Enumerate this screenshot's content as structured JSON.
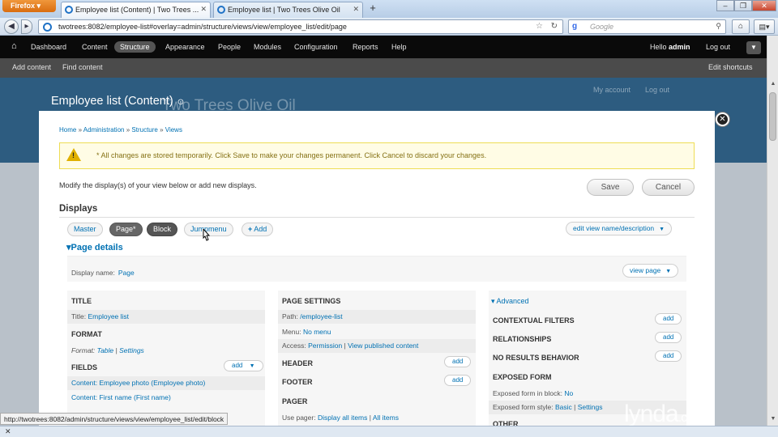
{
  "browser": {
    "firefox_label": "Firefox",
    "tabs": [
      {
        "title": "Employee list (Content) | Two Trees ..."
      },
      {
        "title": "Employee list | Two Trees Olive Oil"
      }
    ],
    "new_tab": "+",
    "url": "twotrees:8082/employee-list#overlay=admin/structure/views/view/employee_list/edit/page",
    "search_placeholder": "Google",
    "status_url": "http://twotrees:8082/admin/structure/views/view/employee_list/edit/block"
  },
  "toolbar": {
    "items": [
      "Dashboard",
      "Content",
      "Structure",
      "Appearance",
      "People",
      "Modules",
      "Configuration",
      "Reports",
      "Help"
    ],
    "hello_prefix": "Hello",
    "username": "admin",
    "logout": "Log out",
    "shortcuts": [
      "Add content",
      "Find content"
    ],
    "edit_shortcuts": "Edit shortcuts"
  },
  "site": {
    "name": "Two Trees Olive Oil",
    "my_account": "My account",
    "log_out": "Log out"
  },
  "overlay": {
    "title": "Employee list (Content)",
    "breadcrumb": [
      "Home",
      "Administration",
      "Structure",
      "Views"
    ],
    "warning": "* All changes are stored temporarily. Click Save to make your changes permanent. Click Cancel to discard your changes.",
    "intro": "Modify the display(s) of your view below or add new displays.",
    "save": "Save",
    "cancel": "Cancel",
    "displays_heading": "Displays",
    "display_tabs": [
      "Master",
      "Page*",
      "Block",
      "Jumpmenu"
    ],
    "add_display": "Add",
    "edit_view_name": "edit view name/description",
    "page_details": "Page details",
    "display_name_label": "Display name:",
    "display_name_value": "Page",
    "view_page": "view page"
  },
  "columns": {
    "left": {
      "title_h": "TITLE",
      "title_label": "Title:",
      "title_value": "Employee list",
      "format_h": "FORMAT",
      "format_label": "Format:",
      "format_value": "Table",
      "format_settings": "Settings",
      "fields_h": "FIELDS",
      "fields_add": "add",
      "fields": [
        "Content: Employee photo (Employee photo)",
        "Content: First name (First name)"
      ]
    },
    "middle": {
      "page_settings_h": "PAGE SETTINGS",
      "path_label": "Path:",
      "path_value": "/employee-list",
      "menu_label": "Menu:",
      "menu_value": "No menu",
      "access_label": "Access:",
      "access_value": "Permission",
      "access_perm": "View published content",
      "header_h": "HEADER",
      "footer_h": "FOOTER",
      "pager_h": "PAGER",
      "pager_label": "Use pager:",
      "pager_value": "Display all items",
      "pager_items": "All items",
      "add": "add"
    },
    "right": {
      "advanced": "Advanced",
      "contextual_filters": "CONTEXTUAL FILTERS",
      "relationships": "RELATIONSHIPS",
      "no_results": "NO RESULTS BEHAVIOR",
      "exposed_form": "EXPOSED FORM",
      "exposed_block_label": "Exposed form in block:",
      "exposed_block_value": "No",
      "exposed_style_label": "Exposed form style:",
      "exposed_style_value": "Basic",
      "exposed_style_settings": "Settings",
      "other": "OTHER",
      "add": "add"
    }
  },
  "watermark": {
    "brand": "lynda",
    "suffix": ".com"
  }
}
